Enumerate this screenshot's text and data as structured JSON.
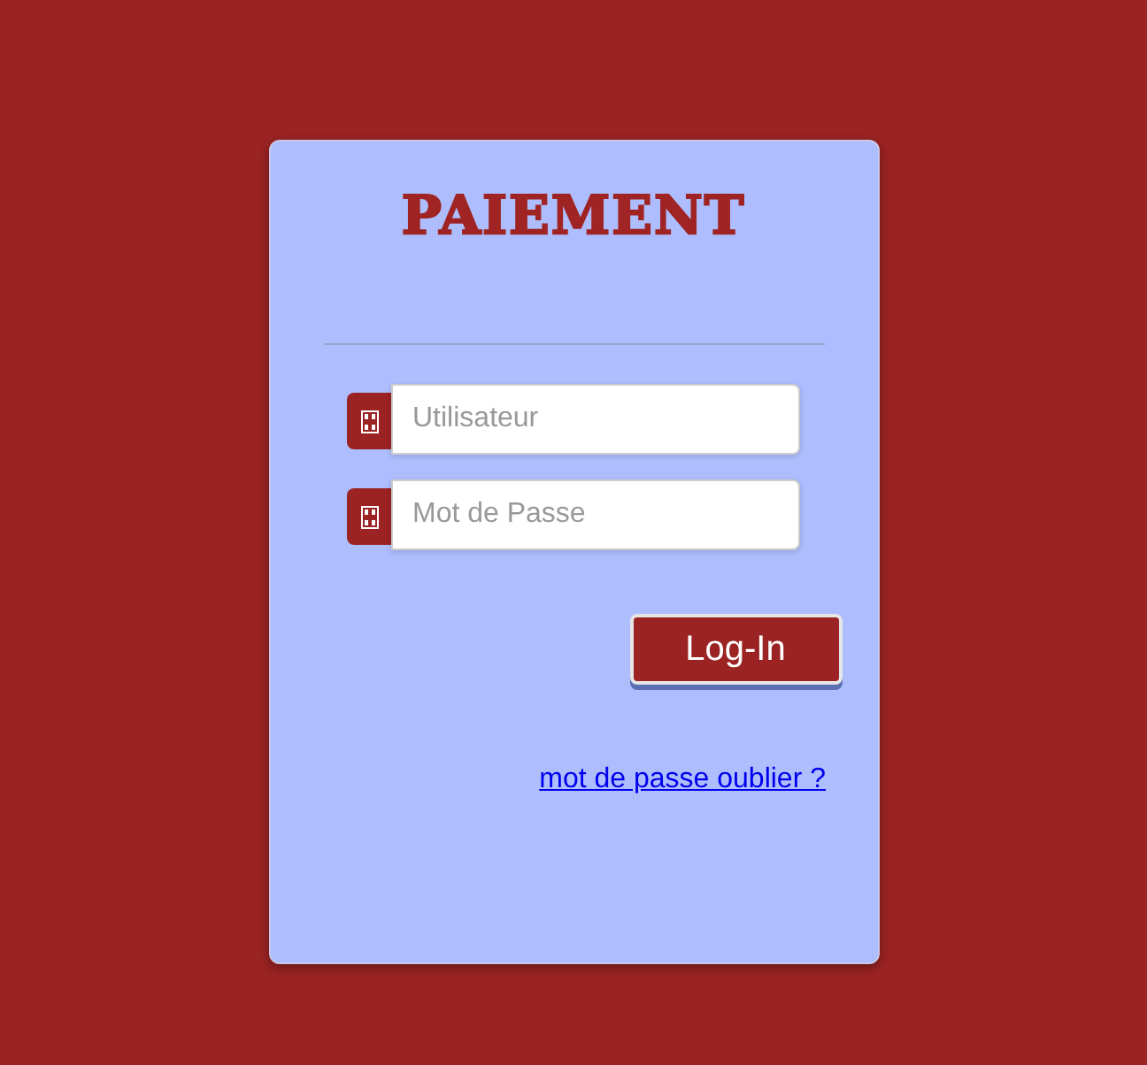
{
  "title": "PAIEMENT",
  "fields": [
    {
      "placeholder": "Utilisateur"
    },
    {
      "placeholder": "Mot de Passe"
    }
  ],
  "button": "Log-In",
  "link": "mot de passe oublier ?"
}
